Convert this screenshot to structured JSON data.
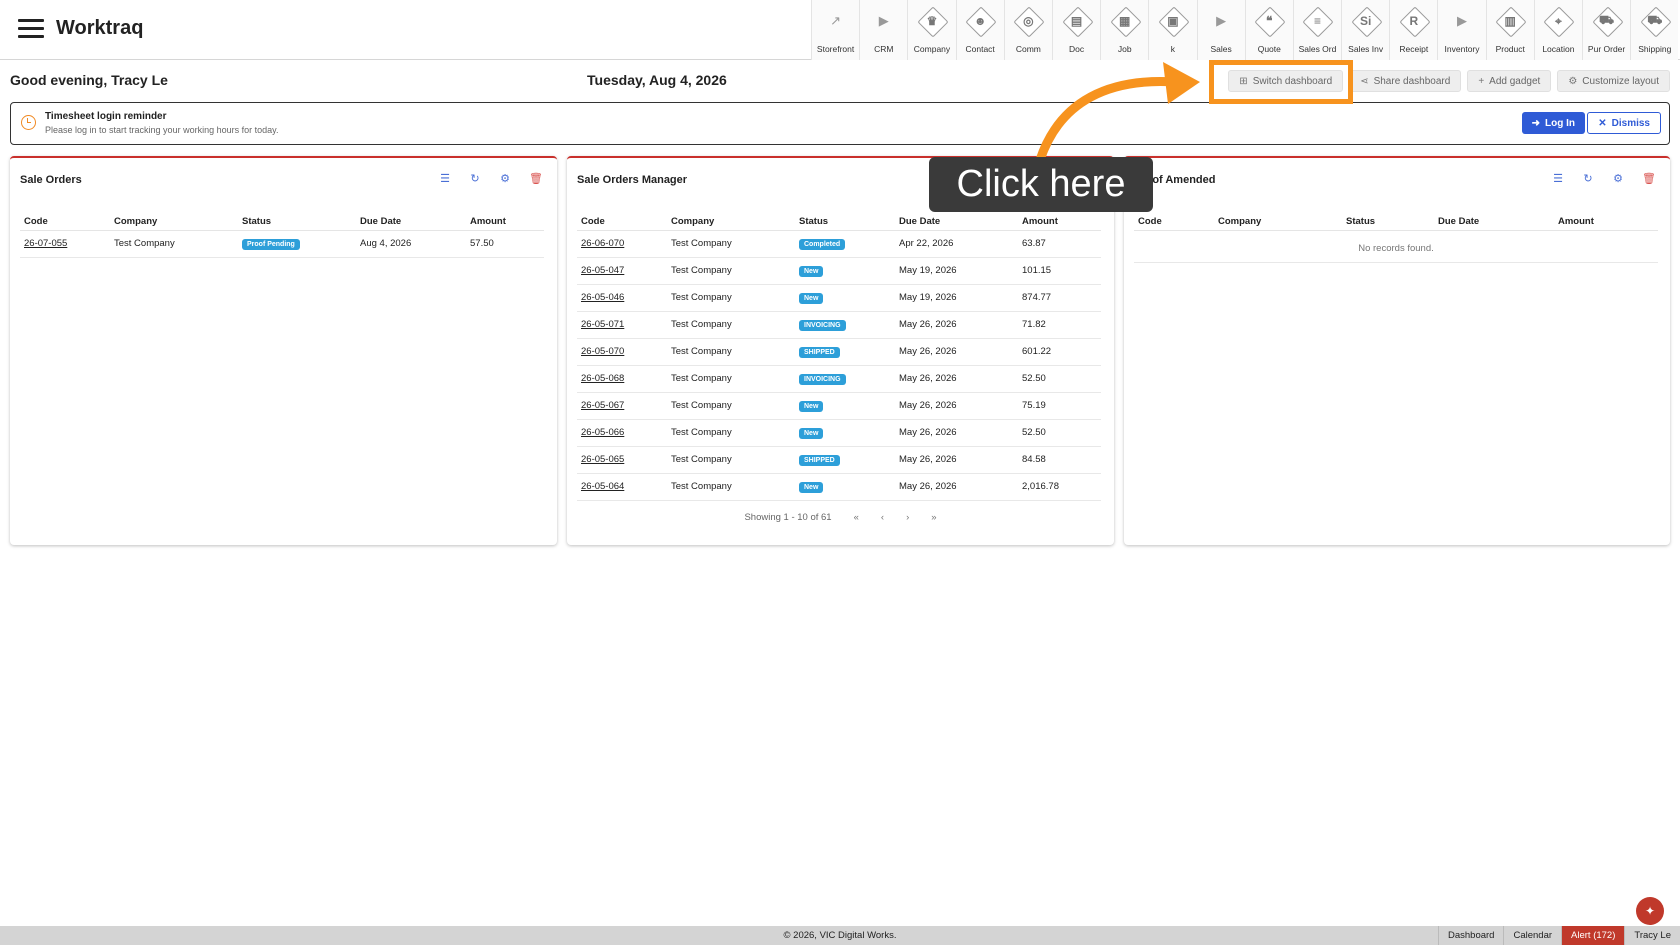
{
  "app": {
    "title": "Worktraq"
  },
  "modules": [
    {
      "label": "Storefront",
      "glyph": "↗",
      "style": "plain"
    },
    {
      "label": "CRM",
      "glyph": "▶",
      "style": "plain"
    },
    {
      "label": "Company",
      "glyph": "♛",
      "style": "dia"
    },
    {
      "label": "Contact",
      "glyph": "☻",
      "style": "dia"
    },
    {
      "label": "Comm",
      "glyph": "◎",
      "style": "dia"
    },
    {
      "label": "Doc",
      "glyph": "▤",
      "style": "dia"
    },
    {
      "label": "Job",
      "glyph": "▦",
      "style": "dia"
    },
    {
      "label": "k",
      "glyph": "▣",
      "style": "dia"
    },
    {
      "label": "Sales",
      "glyph": "▶",
      "style": "plain"
    },
    {
      "label": "Quote",
      "glyph": "❝",
      "style": "dia"
    },
    {
      "label": "Sales Ord",
      "glyph": "≡",
      "style": "dia"
    },
    {
      "label": "Sales Inv",
      "glyph": "Si",
      "style": "dia"
    },
    {
      "label": "Receipt",
      "glyph": "R",
      "style": "dia"
    },
    {
      "label": "Inventory",
      "glyph": "▶",
      "style": "plain"
    },
    {
      "label": "Product",
      "glyph": "▥",
      "style": "dia"
    },
    {
      "label": "Location",
      "glyph": "⌖",
      "style": "dia"
    },
    {
      "label": "Pur Order",
      "glyph": "⛟",
      "style": "dia"
    },
    {
      "label": "Shipping",
      "glyph": "⛟",
      "style": "dia"
    }
  ],
  "header": {
    "greeting": "Good evening, Tracy Le",
    "date": "Tuesday, Aug 4, 2026"
  },
  "actions": {
    "switch": "Switch dashboard",
    "share": "Share dashboard",
    "add": "Add gadget",
    "customize": "Customize layout"
  },
  "reminder": {
    "title": "Timesheet login reminder",
    "text": "Please log in to start tracking your working hours for today.",
    "login": "Log In",
    "dismiss": "Dismiss"
  },
  "columns": [
    "Code",
    "Company",
    "Status",
    "Due Date",
    "Amount"
  ],
  "panels": {
    "sale_orders": {
      "title": "Sale Orders",
      "rows": [
        {
          "code": "26-07-055",
          "company": "Test Company",
          "status": "Proof Pending",
          "due": "Aug 4, 2026",
          "amount": "57.50"
        }
      ]
    },
    "manager": {
      "title": "Sale Orders Manager",
      "rows": [
        {
          "code": "26-06-070",
          "company": "Test Company",
          "status": "Completed",
          "due": "Apr 22, 2026",
          "amount": "63.87"
        },
        {
          "code": "26-05-047",
          "company": "Test Company",
          "status": "New",
          "due": "May 19, 2026",
          "amount": "101.15"
        },
        {
          "code": "26-05-046",
          "company": "Test Company",
          "status": "New",
          "due": "May 19, 2026",
          "amount": "874.77"
        },
        {
          "code": "26-05-071",
          "company": "Test Company",
          "status": "INVOICING",
          "due": "May 26, 2026",
          "amount": "71.82"
        },
        {
          "code": "26-05-070",
          "company": "Test Company",
          "status": "SHIPPED",
          "due": "May 26, 2026",
          "amount": "601.22"
        },
        {
          "code": "26-05-068",
          "company": "Test Company",
          "status": "INVOICING",
          "due": "May 26, 2026",
          "amount": "52.50"
        },
        {
          "code": "26-05-067",
          "company": "Test Company",
          "status": "New",
          "due": "May 26, 2026",
          "amount": "75.19"
        },
        {
          "code": "26-05-066",
          "company": "Test Company",
          "status": "New",
          "due": "May 26, 2026",
          "amount": "52.50"
        },
        {
          "code": "26-05-065",
          "company": "Test Company",
          "status": "SHIPPED",
          "due": "May 26, 2026",
          "amount": "84.58"
        },
        {
          "code": "26-05-064",
          "company": "Test Company",
          "status": "New",
          "due": "May 26, 2026",
          "amount": "2,016.78"
        }
      ],
      "pager": "Showing 1 - 10 of 61"
    },
    "proof": {
      "title": "Proof Amended",
      "empty": "No records found."
    }
  },
  "overlay": {
    "callout": "Click here"
  },
  "footer": {
    "copyright": "© 2026, VIC Digital Works.",
    "dashboard": "Dashboard",
    "calendar": "Calendar",
    "alert": "Alert (172)",
    "user": "Tracy Le"
  },
  "colors": {
    "accent": "#2f5bd6",
    "badge": "#2d9fd9",
    "panel_top": "#c9302c",
    "annotation": "#f7931e"
  }
}
